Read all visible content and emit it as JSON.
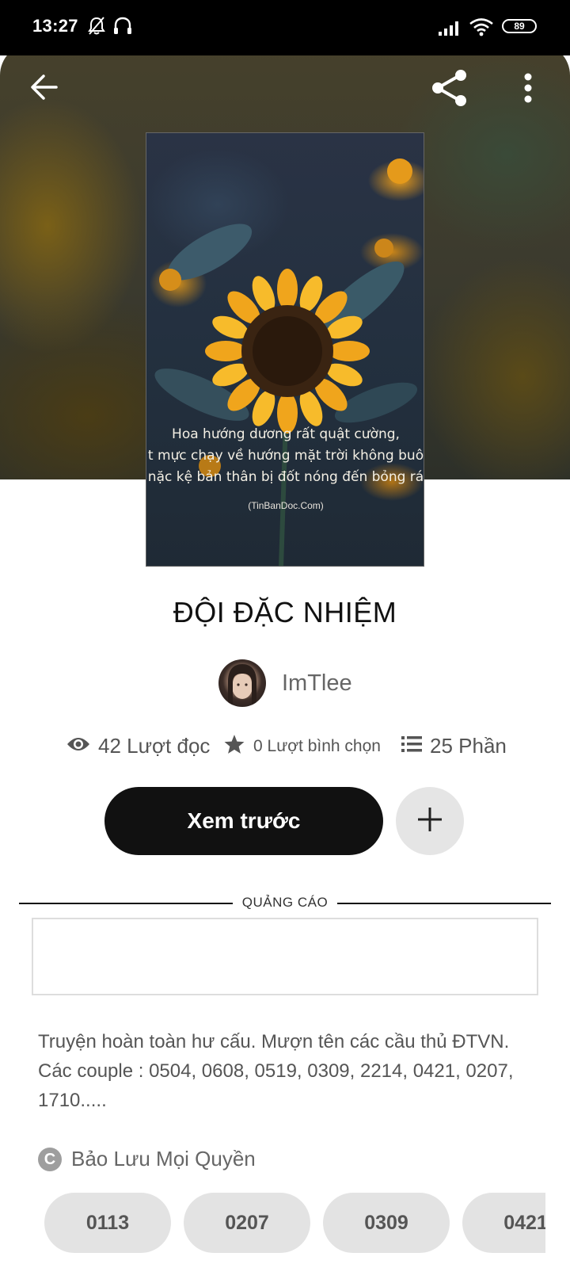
{
  "status_bar": {
    "time": "13:27",
    "battery": "89"
  },
  "toolbar": {
    "back_icon": "arrow-left-icon",
    "share_icon": "share-icon",
    "more_icon": "more-vertical-icon"
  },
  "cover": {
    "quote_lines": [
      "Hoa hướng dương rất quật cường,",
      "t mực chạy về hướng mặt trời không buô",
      "nặc kệ bản thân bị đốt nóng đến bỏng rá"
    ],
    "credit": "(TinBanDoc.Com)"
  },
  "story": {
    "title": "ĐỘI ĐẶC NHIỆM",
    "author": "ImTlee"
  },
  "stats": {
    "reads": "42 Lượt đọc",
    "votes": "0 Lượt bình chọn",
    "parts": "25 Phần"
  },
  "actions": {
    "preview_label": "Xem trước",
    "add_icon": "plus-icon"
  },
  "ad": {
    "label": "QUẢNG CÁO"
  },
  "description": {
    "line1": "Truyện hoàn toàn hư cấu. Mượn tên các cầu thủ ĐTVN.",
    "line2": "Các couple : 0504, 0608, 0519, 0309, 2214, 0421, 0207,",
    "line3": "1710....."
  },
  "rights": {
    "icon_letter": "C",
    "label": "Bảo Lưu Mọi Quyền"
  },
  "tags": [
    "0113",
    "0207",
    "0309",
    "0421"
  ]
}
